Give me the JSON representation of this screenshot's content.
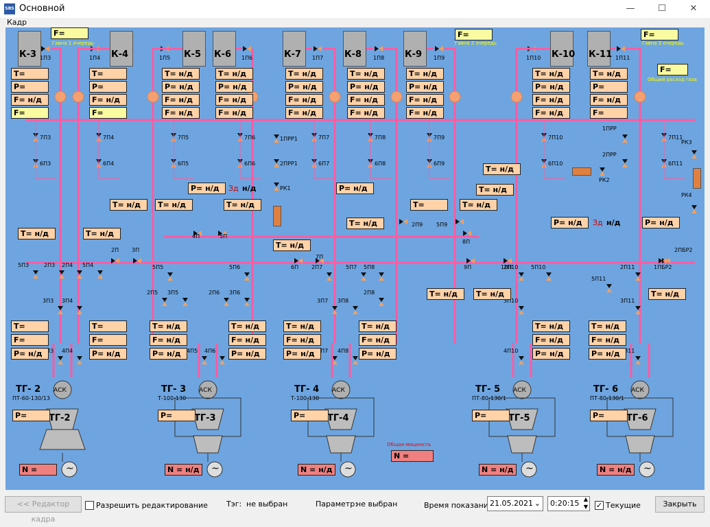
{
  "window": {
    "title": "Основной",
    "icon_text": "SBS",
    "minimize": "—",
    "maximize": "☐",
    "close": "✕"
  },
  "menu": {
    "item": "Кадр"
  },
  "scheme": {
    "boilers": [
      "К-3",
      "К-4",
      "К-5",
      "К-6",
      "К-7",
      "К-8",
      "К-9",
      "К-10",
      "К-11"
    ],
    "flow_labels": {
      "f1": "F=",
      "f1_caption": "Гавна 1 очередь",
      "f2": "F=",
      "f2_caption": "Гавна 2 очередь",
      "f3": "F=",
      "f3_caption": "Гавна 3 очередь",
      "f4": "F=",
      "f4_caption": "Общий расход газа"
    },
    "boiler_params": [
      [
        "T=",
        "P=",
        "F= н/д",
        "F="
      ],
      [
        "T=",
        "P=",
        "F= н/д",
        "F="
      ],
      [
        "T= н/д",
        "P= н/д",
        "F= н/д",
        "F= н/д"
      ],
      [
        "T= н/д",
        "P= н/д",
        "F= н/д",
        "F= н/д"
      ],
      [
        "T= н/д",
        "P= н/д",
        "F= н/д",
        "F= н/д"
      ],
      [
        "T= н/д",
        "P= н/д",
        "F= н/д",
        "F= н/д"
      ],
      [
        "T= н/д",
        "P= н/д",
        "F= н/д",
        "F= н/д"
      ],
      [
        "T= н/д",
        "P= н/д",
        "F= н/д",
        "F= н/д"
      ],
      [
        "T= н/д",
        "P=",
        "F= н/д",
        "F="
      ]
    ],
    "valves_top": [
      "1П3",
      "1П4",
      "1П5",
      "1П6",
      "1П7",
      "1П8",
      "1П9",
      "1П10",
      "1П11"
    ],
    "valves_7": [
      "7П3",
      "7П4",
      "7П5",
      "7П6",
      "7П7",
      "7П8",
      "7П9",
      "7П10",
      "7П11"
    ],
    "valves_6": [
      "6П3",
      "6П4",
      "6П5",
      "6П6",
      "6П7",
      "6П8",
      "6П9",
      "6П10",
      "6П11"
    ],
    "valves_misc": [
      "1ПРР1",
      "2ПРР1",
      "РК1",
      "1ПРР",
      "2ПРР",
      "РК2",
      "РК3",
      "РК4",
      "4П",
      "5П",
      "6П",
      "7П",
      "2П",
      "3П",
      "8П",
      "9П",
      "10П",
      "2ПБР2",
      "1ПБР2",
      "2П9",
      "5П9",
      "2П3",
      "2П4",
      "5П3",
      "5П4",
      "3П3",
      "3П4",
      "4П3",
      "4П4",
      "2П5",
      "3П5",
      "2П6",
      "3П6",
      "5П5",
      "5П6",
      "4П5",
      "4П6",
      "2П7",
      "5П7",
      "5П8",
      "3П7",
      "3П8",
      "2П8",
      "4П7",
      "4П8",
      "2П10",
      "5П10",
      "3П10",
      "4П10",
      "5П11",
      "2П11",
      "3П11",
      "4П11"
    ],
    "header_params": [
      "T= н/д",
      "T= н/д",
      "T= н/д",
      "T= н/д",
      "T= н/д",
      "P= н/д",
      "T= н/д",
      "P= н/д",
      "T= н/д",
      "T= н/д",
      "T=",
      "T= н/д",
      "T= н/д",
      "T= н/д",
      "T= н/д",
      "P= н/д",
      "P= н/д",
      "T= н/д",
      "T= н/д"
    ],
    "zd_text": "Зд",
    "zd_value": "н/д",
    "turbines": [
      {
        "name": "ТГ- 2",
        "model": "ПТ-60-130/13",
        "unit": "ТГ-2",
        "p": "P=",
        "n": "N =",
        "params": [
          "T=",
          "F=",
          "P= н/д",
          "T=",
          "F=",
          "P= н/д"
        ]
      },
      {
        "name": "ТГ- 3",
        "model": "Т-100-130",
        "unit": "ТГ-3",
        "p": "P=",
        "n": "N = н/д",
        "params": [
          "T= н/д",
          "F= н/д",
          "P= н/д",
          "T= н/д",
          "F= н/д",
          "P= н/д"
        ]
      },
      {
        "name": "ТГ- 4",
        "model": "Т-100-130",
        "unit": "ТГ-4",
        "p": "P=",
        "n": "N = н/д",
        "params": [
          "T= н/д",
          "F= н/д",
          "P= н/д",
          "T= н/д",
          "F= н/д",
          "P= н/д"
        ]
      },
      {
        "name": "ТГ- 5",
        "model": "ПТ-80-130/1",
        "unit": "ТГ-5",
        "p": "P=",
        "n": "N = н/д",
        "params": [
          "T= н/д",
          "F= н/д",
          "P= н/д",
          "T= н/д",
          "F= н/д",
          "P= н/д"
        ]
      },
      {
        "name": "ТГ- 6",
        "model": "ПТ-80-130/1",
        "unit": "ТГ-6",
        "p": "P=",
        "n": "N = н/д",
        "params": [
          "T= н/д",
          "F= н/д",
          "P= н/д",
          "T= н/д",
          "F= н/д",
          "P= н/д"
        ]
      }
    ],
    "ask": "АСК",
    "generator_symbol": "~",
    "total_power_caption": "Общая мощность",
    "total_power": "N ="
  },
  "footer": {
    "editor_button": "<< Редактор кадра",
    "allow_edit": "Разрешить редактирование",
    "tag_label": "Тэг:",
    "tag_value": "не выбран",
    "param_label": "Параметр:",
    "param_value": "не выбран",
    "time_label": "Время показаний",
    "date": "21.05.2021",
    "time": "0:20:15",
    "current_label": "Текущие",
    "current_checked": true,
    "close_button": "Закрыть"
  }
}
